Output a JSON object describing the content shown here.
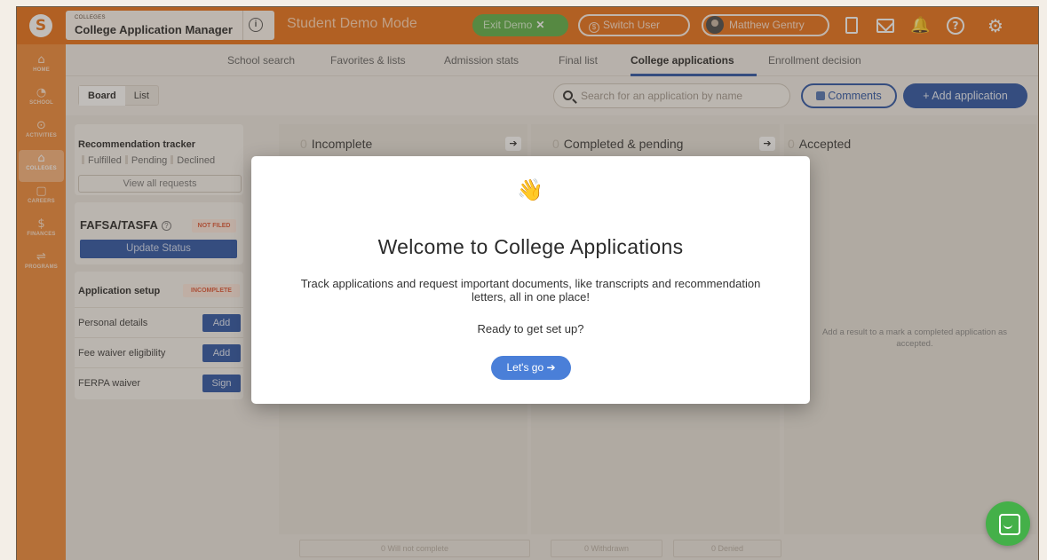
{
  "header": {
    "logo_letter": "S",
    "app_eyebrow": "COLLEGES",
    "app_title": "College Application Manager",
    "info_glyph": "i",
    "demo_mode": "Student Demo Mode",
    "exit_demo": "Exit Demo",
    "exit_x": "✕",
    "switch_user": "Switch User",
    "user_name": "Matthew Gentry"
  },
  "sidebar": {
    "items": [
      {
        "label": "HOME",
        "icon": "home-icon",
        "glyph": "⌂"
      },
      {
        "label": "SCHOOL",
        "icon": "school-icon",
        "glyph": "◔"
      },
      {
        "label": "ACTIVITIES",
        "icon": "activities-icon",
        "glyph": "⊙"
      },
      {
        "label": "COLLEGES",
        "icon": "colleges-icon",
        "glyph": "⌂"
      },
      {
        "label": "CAREERS",
        "icon": "careers-icon",
        "glyph": "▢"
      },
      {
        "label": "FINANCES",
        "icon": "finances-icon",
        "glyph": "$"
      },
      {
        "label": "PROGRAMS",
        "icon": "programs-icon",
        "glyph": "⇌"
      }
    ]
  },
  "subnav": {
    "tabs": [
      "School search",
      "Favorites & lists",
      "Admission stats",
      "Final list",
      "College applications",
      "Enrollment decision"
    ]
  },
  "toolbar": {
    "board": "Board",
    "list": "List",
    "search_placeholder": "Search for an application by name",
    "comments": "Comments",
    "add_application": "+ Add application"
  },
  "tracker": {
    "title": "Recommendation tracker",
    "fulfilled": "Fulfilled",
    "pending": "Pending",
    "declined": "Declined",
    "view_all": "View all requests"
  },
  "fafsa": {
    "title": "FAFSA/TASFA",
    "help": "?",
    "status": "NOT FILED",
    "update": "Update Status"
  },
  "setup": {
    "title": "Application setup",
    "status": "INCOMPLETE",
    "rows": [
      {
        "label": "Personal details",
        "action": "Add"
      },
      {
        "label": "Fee waiver eligibility",
        "action": "Add"
      },
      {
        "label": "FERPA waiver",
        "action": "Sign"
      }
    ]
  },
  "columns": [
    {
      "count": "0",
      "title": "Incomplete"
    },
    {
      "count": "0",
      "title": "Completed & pending"
    },
    {
      "count": "0",
      "title": "Accepted",
      "empty": "Add a result to a mark a completed application as accepted."
    }
  ],
  "footer_buttons": [
    "0 Will not complete",
    "0 Withdrawn",
    "0 Denied"
  ],
  "modal": {
    "emoji": "👋",
    "title": "Welcome to College Applications",
    "description": "Track applications and request important documents, like transcripts and recommendation letters, all in one place!",
    "question": "Ready to get set up?",
    "cta": "Let's go ➔"
  },
  "icons": {
    "doc": "document-icon",
    "mail": "mail-icon",
    "bell": "bell-icon",
    "help": "help-icon",
    "gear": "gear-icon",
    "chat": "chat-icon",
    "bell_glyph": "🔔",
    "gear_glyph": "⚙",
    "help_glyph": "?",
    "arrow_glyph": "➔"
  },
  "colors": {
    "brand_orange": "#e9731b",
    "primary_blue": "#2c56a6",
    "success_green": "#44b049"
  }
}
